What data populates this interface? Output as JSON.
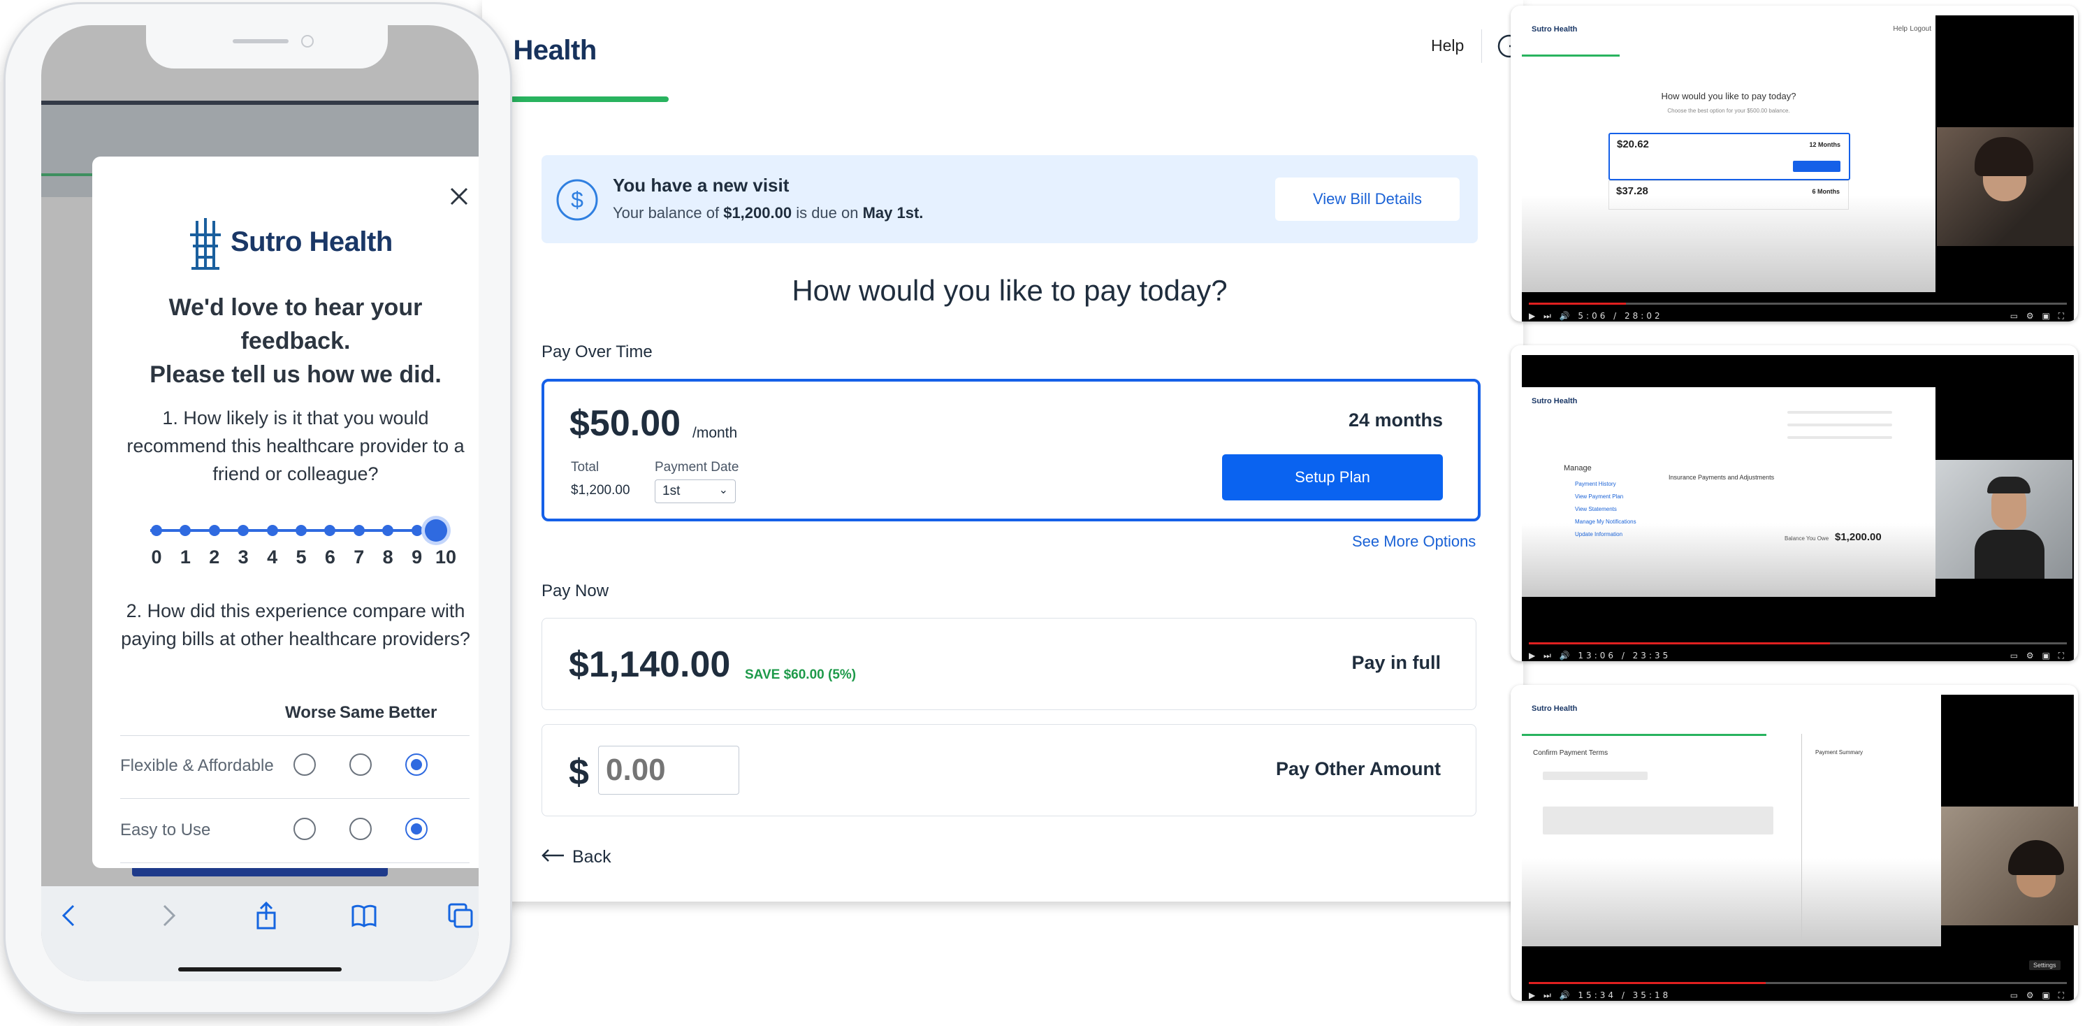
{
  "app": {
    "brand_partial": "o Health",
    "help_label": "Help",
    "notice": {
      "title": "You have a new visit",
      "body_prefix": "Your balance of ",
      "body_amount": "$1,200.00",
      "body_mid": " is due on ",
      "body_date": "May 1st.",
      "button": "View Bill Details"
    },
    "question": "How would you like to pay today?",
    "pay_over_time": {
      "section_label": "Pay Over Time",
      "amount": "$50.00",
      "period": "/month",
      "months": "24 months",
      "total_label": "Total",
      "total_value": "$1,200.00",
      "date_label": "Payment Date",
      "date_value": "1st",
      "button": "Setup Plan",
      "see_more": "See More Options"
    },
    "pay_now": {
      "section_label": "Pay Now",
      "full_amount": "$1,140.00",
      "save_text": "SAVE $60.00 (5%)",
      "full_label": "Pay in full",
      "currency": "$",
      "other_placeholder": "0.00",
      "other_label": "Pay Other Amount"
    },
    "back_label": "Back"
  },
  "phone": {
    "modal": {
      "brand": "Sutro Health",
      "heading": [
        "We'd love to hear your",
        "feedback.",
        "Please tell us how we did."
      ],
      "q1": "1. How likely is it that you would recommend this healthcare provider to a friend or colleague?",
      "scale": [
        "0",
        "1",
        "2",
        "3",
        "4",
        "5",
        "6",
        "7",
        "8",
        "9",
        "10"
      ],
      "selected_score": 10,
      "q2": "2. How did this experience compare with paying bills at other healthcare providers?",
      "columns": [
        "Worse",
        "Same",
        "Better"
      ],
      "rows": [
        {
          "label": "Flexible & Affordable",
          "selected": "Better"
        },
        {
          "label": "Easy to Use",
          "selected": "Better"
        }
      ]
    },
    "safari_icons": [
      "back-icon",
      "forward-icon",
      "share-icon",
      "bookmarks-icon",
      "tabs-icon"
    ]
  },
  "videos": [
    {
      "brand": "Sutro Health",
      "slide_title": "How would you like to pay today?",
      "slide_sub": "Choose the best option for your $500.00 balance.",
      "amount_1": "$20.62",
      "amount_1_months": "12 Months",
      "amount_2": "$37.28",
      "amount_2_months": "6 Months",
      "help": "Help",
      "logout": "Logout",
      "time": "5:06 / 28:02",
      "progress": 0.18
    },
    {
      "brand": "Sutro Health",
      "manage_heading": "Manage",
      "manage_items": [
        "Payment History",
        "View Payment Plan",
        "View Statements",
        "Manage My Notifications",
        "Update Information"
      ],
      "insurance_heading": "Insurance Payments and Adjustments",
      "balance_label": "Balance You Owe",
      "balance_value": "$1,200.00",
      "time": "13:06 / 23:35",
      "progress": 0.56
    },
    {
      "brand": "Sutro Health",
      "slide_title": "Confirm Payment Terms",
      "summary_title": "Payment Summary",
      "settings_label": "Settings",
      "time": "15:34 / 35:18",
      "progress": 0.44
    }
  ]
}
